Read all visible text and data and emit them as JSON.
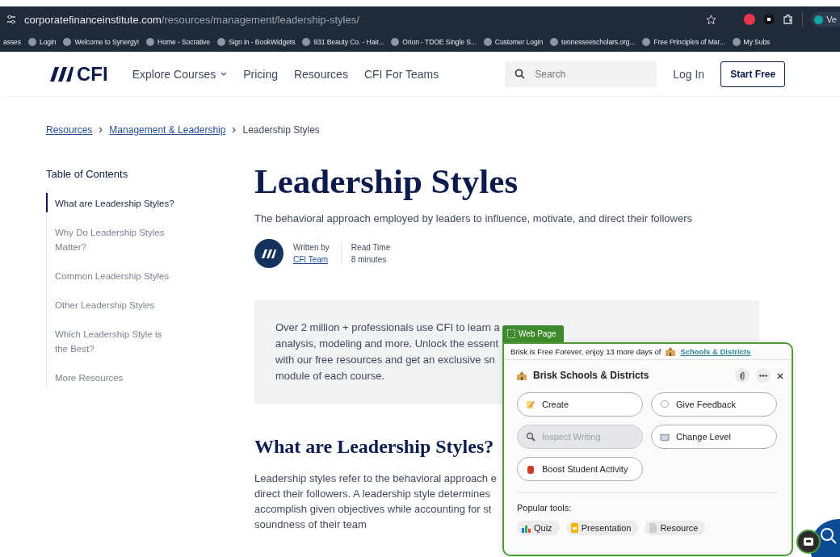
{
  "browser": {
    "url_host": "corporatefinanceinstitute.com",
    "url_path": "/resources/management/leadership-styles/",
    "profile_label": "Ve",
    "bookmarks": [
      {
        "label": "asses"
      },
      {
        "label": "Login"
      },
      {
        "label": "Welcome to Synergy!"
      },
      {
        "label": "Home - Socrative"
      },
      {
        "label": "Sign in - BookWidgets"
      },
      {
        "label": "931 Beauty Co. - Hair..."
      },
      {
        "label": "Orion - TDOE Single S..."
      },
      {
        "label": "Customer Login"
      },
      {
        "label": "tennesseescholars.org..."
      },
      {
        "label": "Free Principles of Mar..."
      },
      {
        "label": "My Subs"
      }
    ]
  },
  "nav": {
    "logo": "CFI",
    "links": [
      {
        "label": "Explore Courses",
        "has_caret": true
      },
      {
        "label": "Pricing",
        "has_caret": false
      },
      {
        "label": "Resources",
        "has_caret": false
      },
      {
        "label": "CFI For Teams",
        "has_caret": false
      }
    ],
    "search_placeholder": "Search",
    "login": "Log In",
    "cta": "Start Free"
  },
  "breadcrumb": [
    {
      "label": "Resources",
      "link": true
    },
    {
      "label": "Management & Leadership",
      "link": true
    },
    {
      "label": "Leadership Styles",
      "link": false
    }
  ],
  "toc": {
    "title": "Table of Contents",
    "items": [
      {
        "label": "What are Leadership Styles?",
        "selected": true
      },
      {
        "label": "Why Do Leadership Styles Matter?",
        "selected": false
      },
      {
        "label": "Common Leadership Styles",
        "selected": false
      },
      {
        "label": "Other Leadership Styles",
        "selected": false
      },
      {
        "label": "Which Leadership Style is the Best?",
        "selected": false
      },
      {
        "label": "More Resources",
        "selected": false
      }
    ]
  },
  "article": {
    "title": "Leadership Styles",
    "subtitle": "The behavioral approach employed by leaders to influence, motivate, and direct their followers",
    "author_label": "Written by",
    "author": "CFI Team",
    "read_label": "Read Time",
    "read_time": "8 minutes",
    "callout_lines": [
      "Over 2 million + professionals use CFI to learn a",
      "analysis, modeling and more. Unlock the essent",
      "with our free resources and get an exclusive sn",
      "module of each course."
    ],
    "heading": "What are Leadership Styles?",
    "body_lines": [
      "Leadership styles refer to the behavioral approach e",
      "direct their followers. A leadership style determines",
      "accomplish given objectives while accounting for st",
      "soundness of their team"
    ]
  },
  "brisk": {
    "tab": "Web Page",
    "banner_text": "Brisk is Free Forever, enjoy 13 more days of",
    "banner_link": "Schools & Districts",
    "title": "Brisk Schools & Districts",
    "actions": [
      {
        "label": "Create",
        "kind": "pencil",
        "disabled": false
      },
      {
        "label": "Give Feedback",
        "kind": "speech",
        "disabled": false
      },
      {
        "label": "Inspect Writing",
        "kind": "magnifier",
        "disabled": true
      },
      {
        "label": "Change Level",
        "kind": "book",
        "disabled": false
      },
      {
        "label": "Boost Student Activity",
        "kind": "backpack",
        "disabled": false
      }
    ],
    "popular_label": "Popular tools:",
    "tools": [
      {
        "label": "Quiz",
        "kind": "chart"
      },
      {
        "label": "Presentation",
        "kind": "slides"
      },
      {
        "label": "Resource",
        "kind": "doc"
      }
    ]
  }
}
